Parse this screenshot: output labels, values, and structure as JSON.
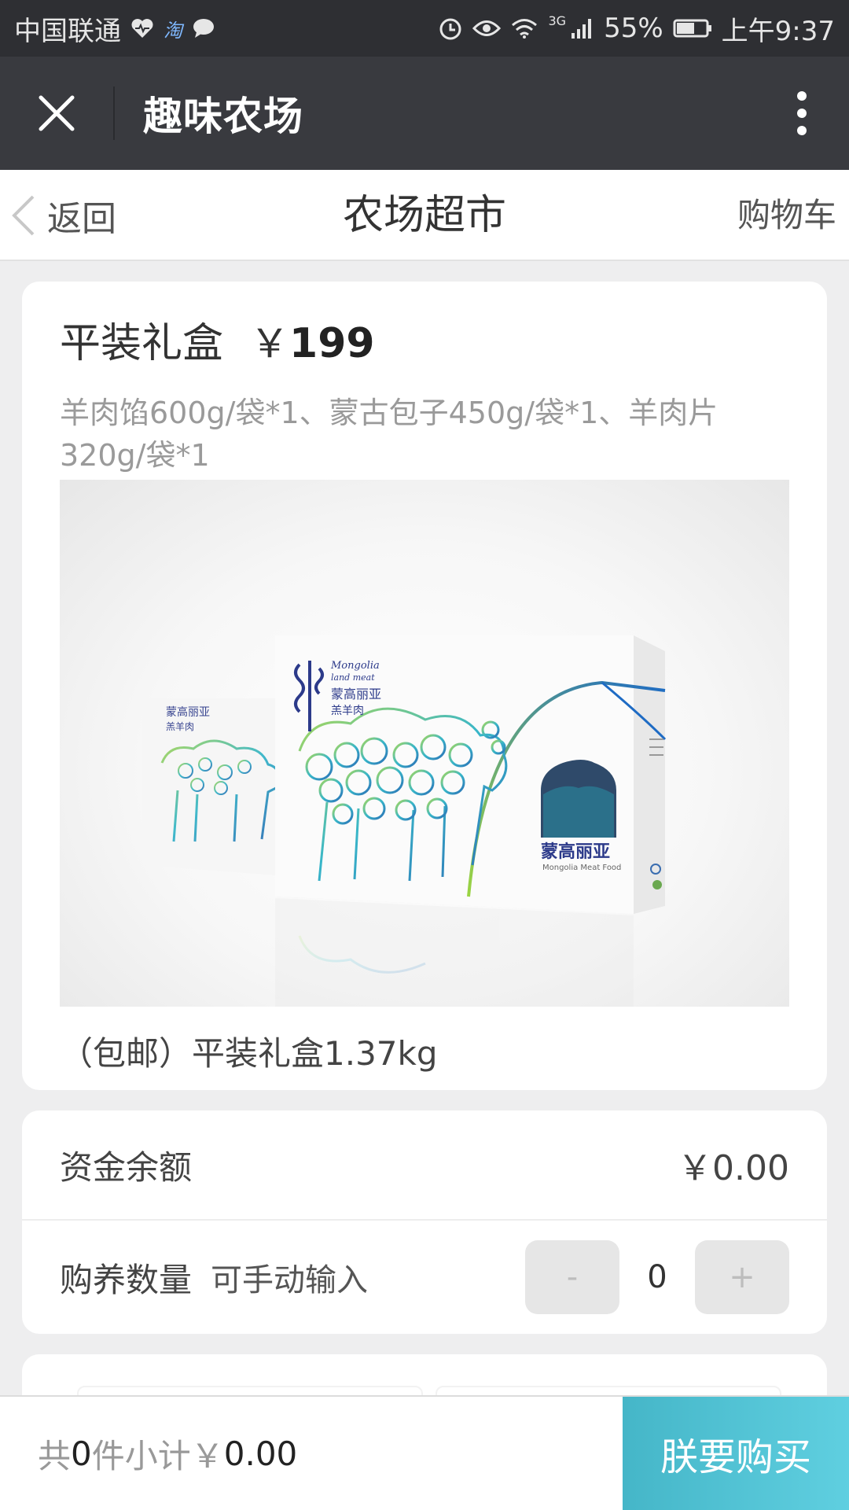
{
  "status_bar": {
    "carrier": "中国联通",
    "taobao_label": "淘",
    "network": "3G",
    "battery": "55%",
    "time": "上午9:37"
  },
  "title_bar": {
    "title": "趣味农场",
    "close_icon": "close-icon",
    "more_icon": "more-vertical-icon"
  },
  "header": {
    "back_label": "返回",
    "title": "农场超市",
    "cart_label": "购物车"
  },
  "product": {
    "name": "平装礼盒",
    "currency": "￥",
    "price": "199",
    "description": "羊肉馅600g/袋*1、蒙古包子450g/袋*1、羊肉片320g/袋*1",
    "caption": "（包邮）平装礼盒1.37kg",
    "image_text": {
      "cn_brand": "蒙高丽亚",
      "cn_sub": "羔羊肉",
      "en_brand": "Mongolia",
      "en_sub": "land meat",
      "side_brand": "蒙高丽亚",
      "side_en": "Mongolia Meat Food"
    }
  },
  "balance": {
    "label": "资金余额",
    "value": "￥0.00"
  },
  "quantity": {
    "label": "购养数量",
    "hint": "可手动输入",
    "minus": "-",
    "value": "0",
    "plus": "+"
  },
  "footer": {
    "prefix": "共",
    "count": "0",
    "middle": "件小计￥",
    "subtotal": "0.00",
    "buy_label": "朕要购买"
  },
  "colors": {
    "status_bar_bg": "#2e2f33",
    "title_bar_bg": "#393a3f",
    "buy_button": "#4fc1d3",
    "page_bg": "#eeeeef"
  }
}
